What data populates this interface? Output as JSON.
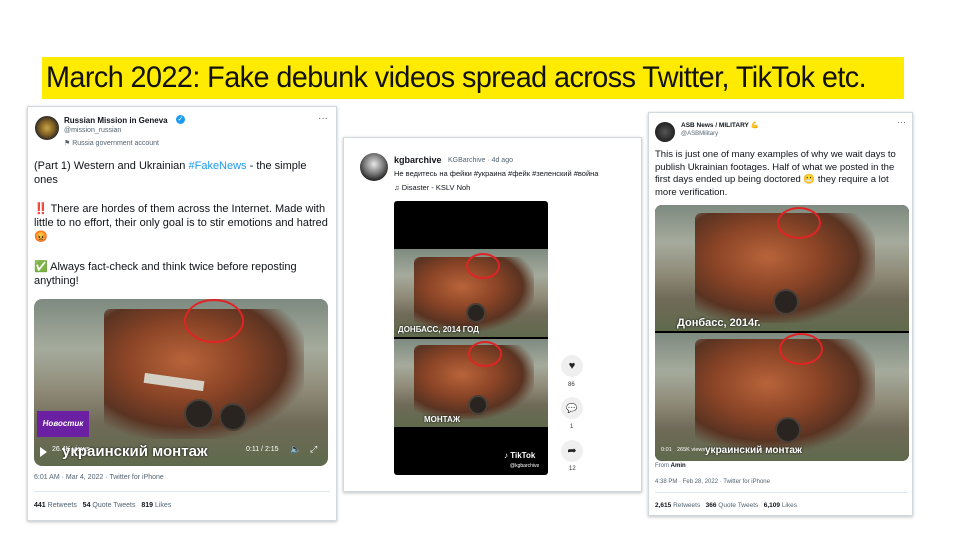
{
  "slide": {
    "title": "March 2022: Fake debunk videos spread across Twitter, TikTok etc."
  },
  "tweet1": {
    "name": "Russian Mission in Geneva",
    "handle": "@mission_russian",
    "account_label": "⚑ Russia government account",
    "text_line1_pre": "(Part 1) Western and Ukrainian ",
    "hashtag": "#FakeNews",
    "text_line1_post": " - the simple ones",
    "para2_icon": "‼️",
    "para2": "There are hordes of them across the Internet. Made with little to no effort, their only goal is to stir emotions and hatred",
    "para2_emoji": "😡",
    "para3_icon": "✅",
    "para3": "Always fact-check and think twice before reposting anything!",
    "video_views": "26.4K views",
    "video_time": "0:11 / 2:15",
    "video_caption": "украинский монтаж",
    "watermark": "Новостик",
    "timestamp": "6:01 AM · Mar 4, 2022 · Twitter for iPhone",
    "retweets": "441",
    "retweets_label": "Retweets",
    "quotes": "54",
    "quotes_label": "Quote Tweets",
    "likes": "819",
    "likes_label": "Likes"
  },
  "tiktok": {
    "name": "kgbarchive",
    "handle_time": "KGBarchive · 4d ago",
    "caption": "Не ведитесь на фейки #украина #фейк #зеленский #война",
    "sound": "♫ Disaster - KSLV Noh",
    "caption_top": "ДОНБАСС, 2014 ГОД",
    "caption_bottom": "МОНТАЖ",
    "logo": "TikTok",
    "logo_handle": "@kgbarchive",
    "likes": "86",
    "comments": "1",
    "shares": "12"
  },
  "tweet3": {
    "name": "ASB News / MILITARY",
    "handle": "@ASBMilitary",
    "text": "This is just one of many examples of why we wait days to publish Ukrainian footages. Half of what we posted in the first days ended up being doctored",
    "text_emoji": "😬",
    "text_end": " they require a lot more verification.",
    "caption_top": "Донбасс, 2014г.",
    "caption_bottom": "украинский монтаж",
    "video_time": "0:01",
    "video_views": "265K views",
    "from_label": "From",
    "from_name": "Amin",
    "timestamp": "4:38 PM · Feb 28, 2022 · Twitter for iPhone",
    "retweets": "2,615",
    "retweets_label": "Retweets",
    "quotes": "366",
    "quotes_label": "Quote Tweets",
    "likes": "6,109",
    "likes_label": "Likes"
  },
  "colors": {
    "title_highlight": "#ffeb00",
    "hashtag": "#1d9bf0",
    "verified": "#1d9bf0",
    "red_mark": "#e02424"
  }
}
